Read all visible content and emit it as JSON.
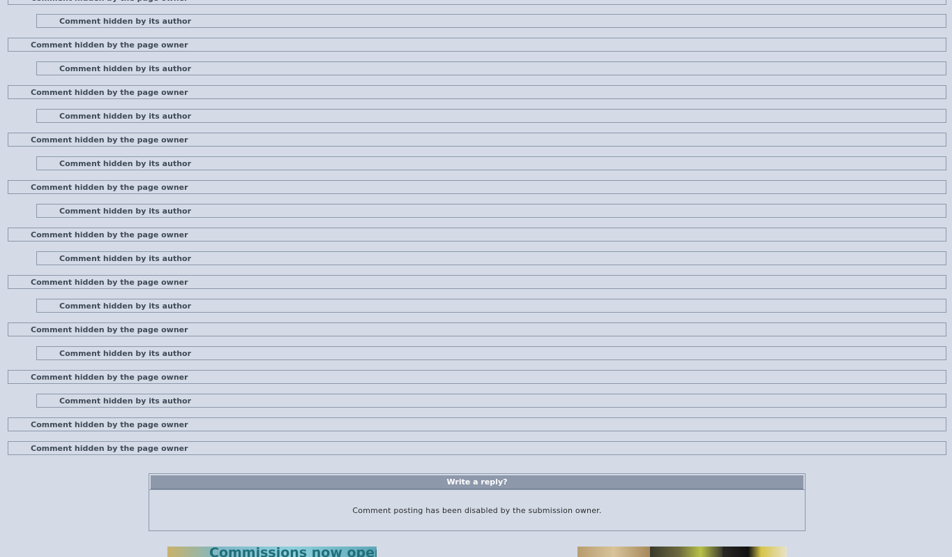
{
  "comments": [
    {
      "kind": "owner",
      "text": "Comment hidden by the page owner"
    },
    {
      "kind": "author",
      "text": "Comment hidden by its author"
    },
    {
      "kind": "owner",
      "text": "Comment hidden by the page owner"
    },
    {
      "kind": "author",
      "text": "Comment hidden by its author"
    },
    {
      "kind": "owner",
      "text": "Comment hidden by the page owner"
    },
    {
      "kind": "author",
      "text": "Comment hidden by its author"
    },
    {
      "kind": "owner",
      "text": "Comment hidden by the page owner"
    },
    {
      "kind": "author",
      "text": "Comment hidden by its author"
    },
    {
      "kind": "owner",
      "text": "Comment hidden by the page owner"
    },
    {
      "kind": "author",
      "text": "Comment hidden by its author"
    },
    {
      "kind": "owner",
      "text": "Comment hidden by the page owner"
    },
    {
      "kind": "author",
      "text": "Comment hidden by its author"
    },
    {
      "kind": "owner",
      "text": "Comment hidden by the page owner"
    },
    {
      "kind": "author",
      "text": "Comment hidden by its author"
    },
    {
      "kind": "owner",
      "text": "Comment hidden by the page owner"
    },
    {
      "kind": "author",
      "text": "Comment hidden by its author"
    },
    {
      "kind": "owner",
      "text": "Comment hidden by the page owner"
    },
    {
      "kind": "author",
      "text": "Comment hidden by its author"
    },
    {
      "kind": "owner",
      "text": "Comment hidden by the page owner"
    },
    {
      "kind": "owner",
      "text": "Comment hidden by the page owner"
    }
  ],
  "reply": {
    "title": "Write a reply?",
    "message": "Comment posting has been disabled by the submission owner."
  },
  "banners": {
    "left_text": "Commissions now open!"
  },
  "colors": {
    "background": "#d4dbe6",
    "border": "#8a97aa",
    "header": "#8e98ab",
    "comment_text": "#3f4a57"
  }
}
